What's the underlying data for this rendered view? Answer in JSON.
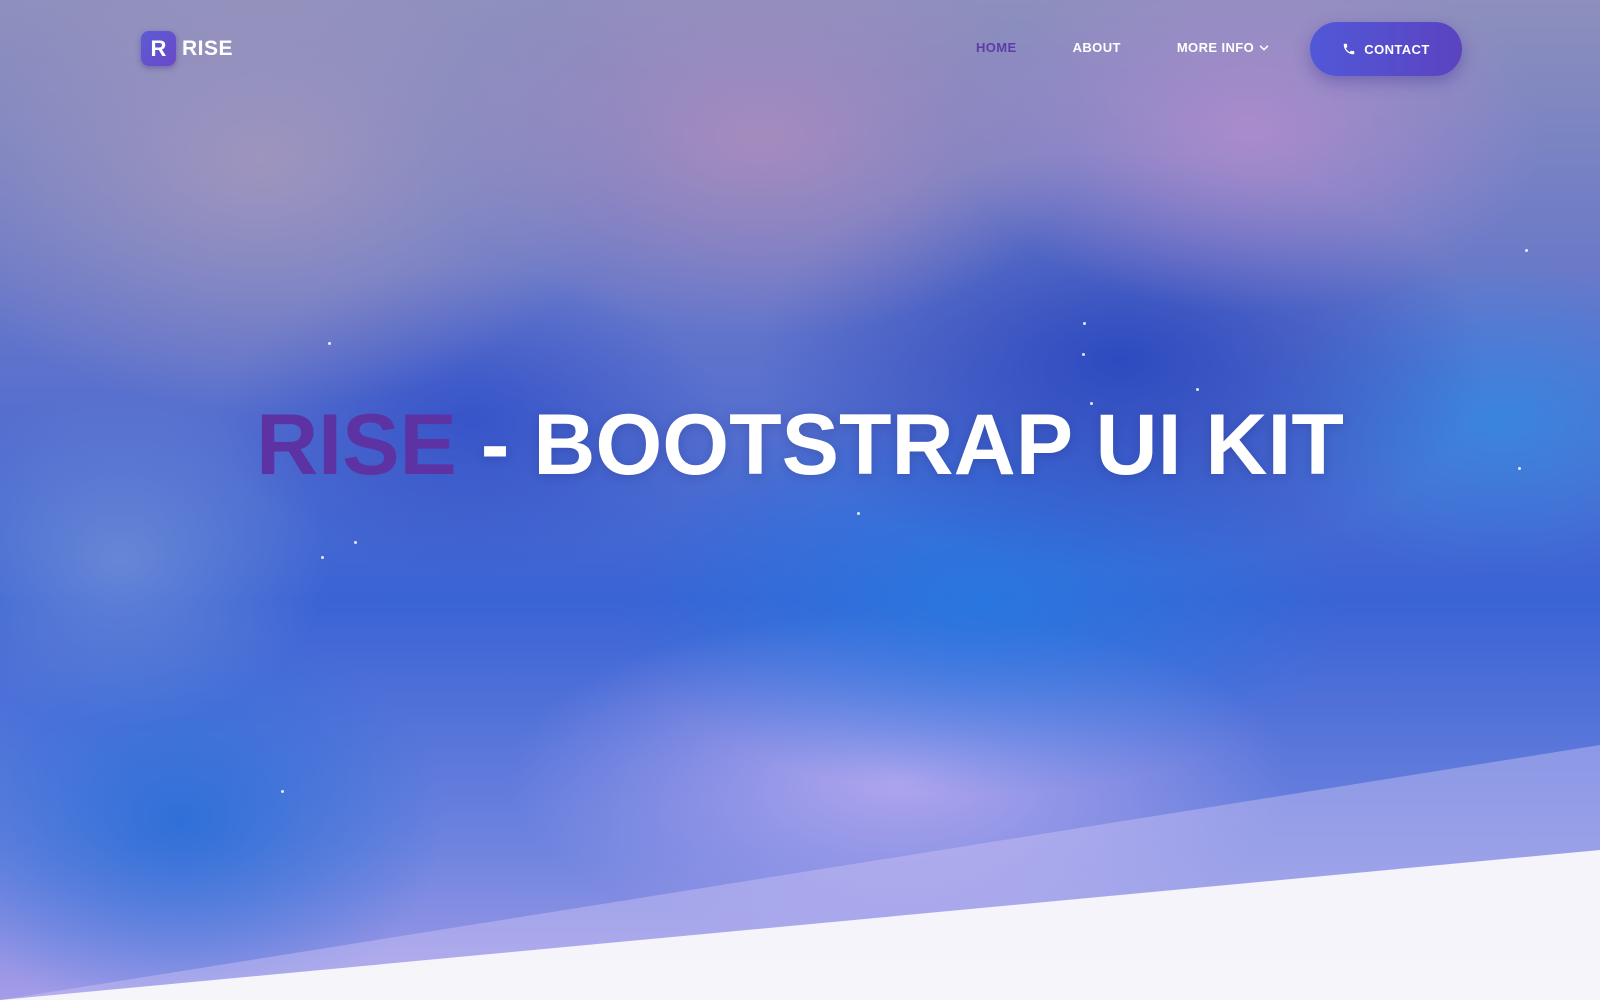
{
  "brand": {
    "mark": "R",
    "name": "RISE"
  },
  "nav": {
    "items": [
      {
        "label": "HOME",
        "active": true
      },
      {
        "label": "ABOUT",
        "active": false
      },
      {
        "label": "MORE INFO",
        "active": false,
        "dropdown": true
      }
    ],
    "contact_label": "CONTACT"
  },
  "hero": {
    "title_accent": "RISE",
    "title_rest": " - BOOTSTRAP UI KIT"
  },
  "colors": {
    "accent": "#5d32a3",
    "nav_active": "#5a3ea6",
    "button": "#5550cf",
    "text_light": "#ffffff"
  },
  "icons": {
    "chevron": "chevron-down-icon",
    "phone": "phone-icon"
  }
}
